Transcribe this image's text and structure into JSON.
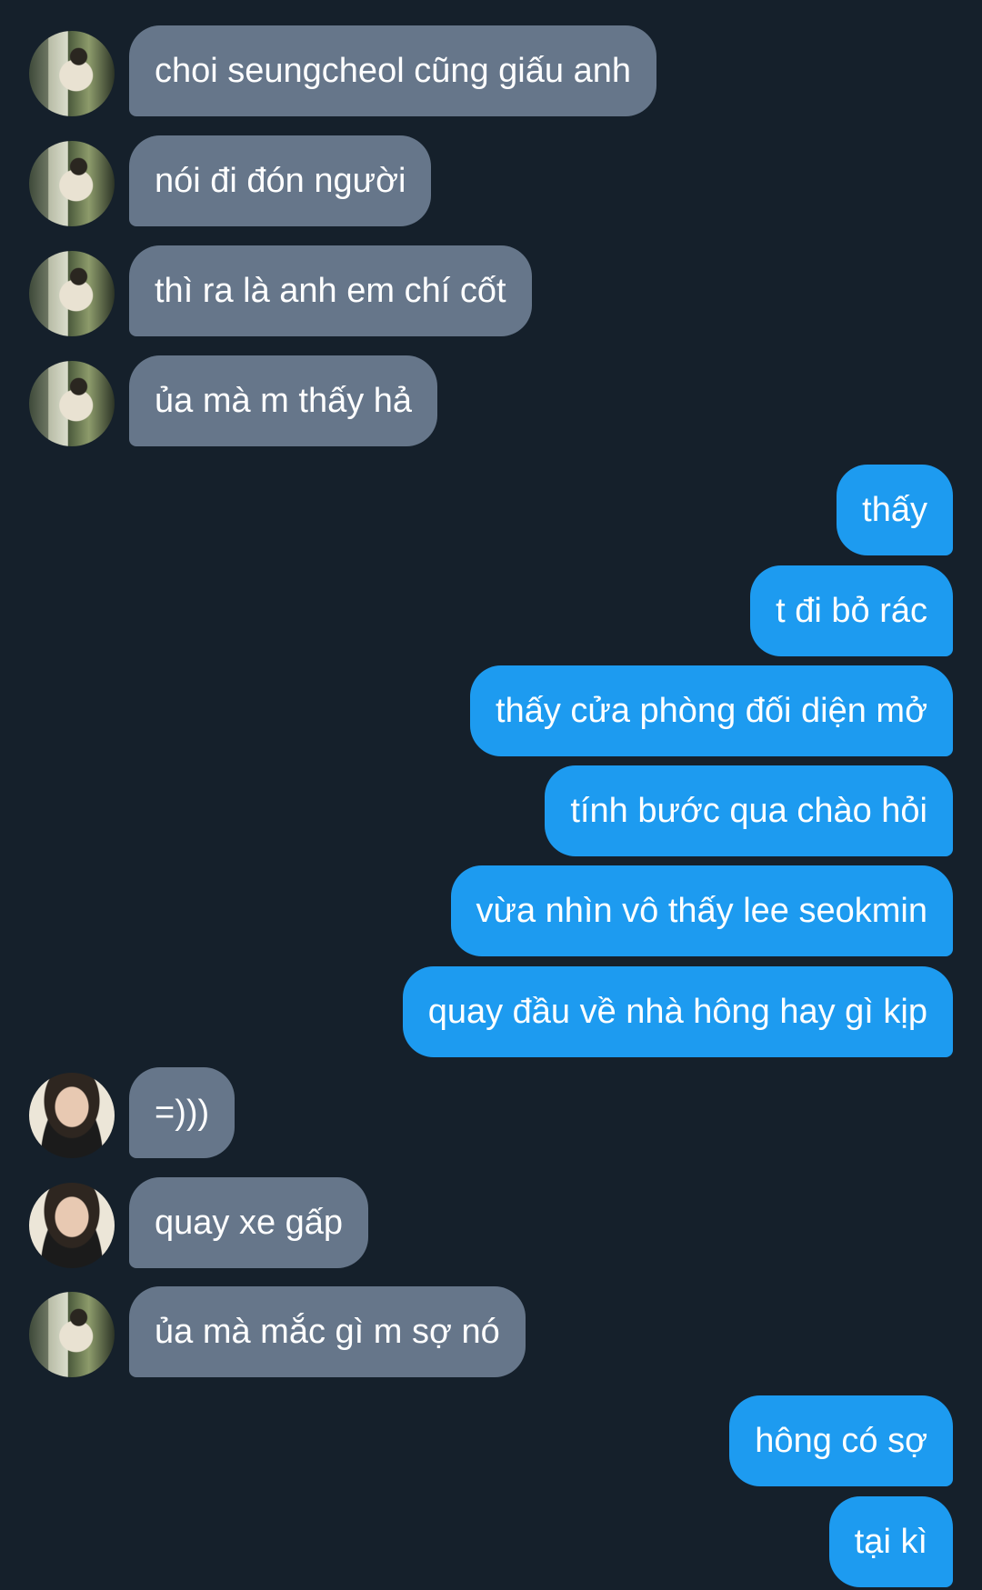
{
  "conversation": {
    "messages": [
      {
        "side": "in",
        "avatar": "a",
        "text": "choi seungcheol cũng giấu anh"
      },
      {
        "side": "in",
        "avatar": "a",
        "text": "nói đi đón người"
      },
      {
        "side": "in",
        "avatar": "a",
        "text": "thì ra là anh em chí cốt"
      },
      {
        "side": "in",
        "avatar": "a",
        "text": "ủa mà m thấy hả"
      },
      {
        "side": "out",
        "text": "thấy"
      },
      {
        "side": "out",
        "text": "t đi bỏ rác"
      },
      {
        "side": "out",
        "text": "thấy cửa phòng đối diện mở"
      },
      {
        "side": "out",
        "text": "tính bước qua chào hỏi"
      },
      {
        "side": "out",
        "text": "vừa nhìn vô thấy lee seokmin"
      },
      {
        "side": "out",
        "text": "quay đầu về nhà hông hay gì kịp"
      },
      {
        "side": "in",
        "avatar": "b",
        "text": "=)))"
      },
      {
        "side": "in",
        "avatar": "b",
        "text": "quay xe gấp"
      },
      {
        "side": "in",
        "avatar": "a",
        "text": "ủa mà mắc gì m sợ nó"
      },
      {
        "side": "out",
        "text": "hông có sợ"
      },
      {
        "side": "out",
        "text": "tại kì"
      }
    ]
  },
  "colors": {
    "background": "#15202b",
    "incoming_bubble": "#66768a",
    "outgoing_bubble": "#1d9bf0",
    "text": "#ffffff"
  },
  "icons": {
    "avatar_a": "profile-photo",
    "avatar_b": "profile-photo"
  }
}
